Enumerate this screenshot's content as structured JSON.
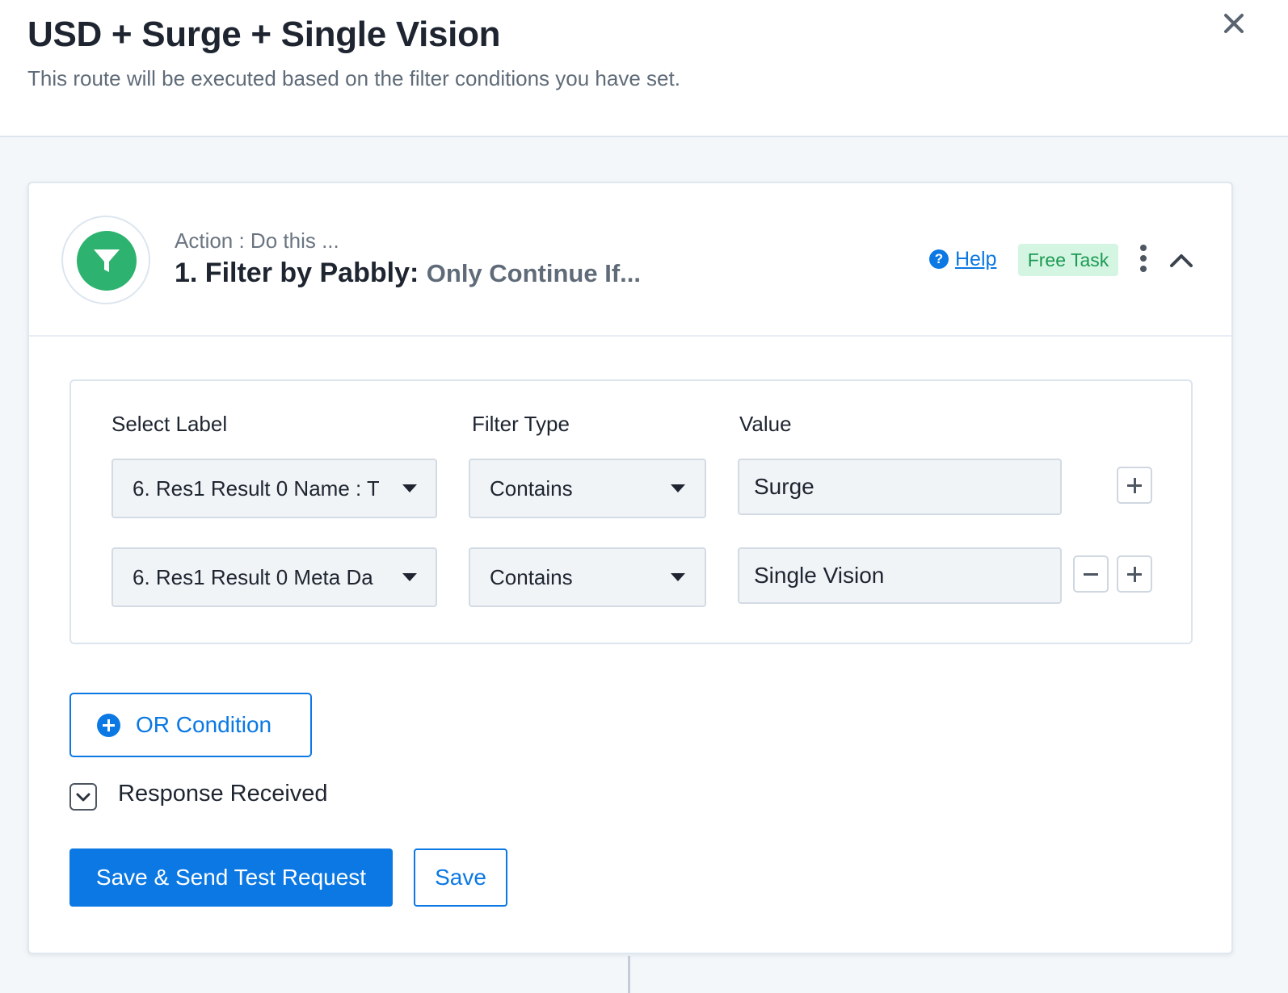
{
  "modal": {
    "title": "USD + Surge + Single Vision",
    "subtitle": "This route will be executed based on the filter conditions you have set.",
    "close_icon": "close-icon"
  },
  "step": {
    "caption": "Action : Do this ...",
    "title": "1. Filter by Pabbly:",
    "subtitle": "Only Continue If...",
    "app_icon": "filter-icon",
    "app_color": "#2db36f",
    "help_label": "Help",
    "badge_label": "Free Task",
    "badge_color": "#d5f5e3"
  },
  "filter": {
    "columns": {
      "label": "Select Label",
      "type": "Filter Type",
      "value": "Value"
    },
    "rows": [
      {
        "label": "6. Res1 Result 0 Name : T",
        "type": "Contains",
        "value": "Surge"
      },
      {
        "label": "6. Res1 Result 0 Meta Da",
        "type": "Contains",
        "value": "Single Vision"
      }
    ]
  },
  "or_condition_label": "OR Condition",
  "response_label": "Response Received",
  "buttons": {
    "save_send": "Save & Send Test Request",
    "save": "Save"
  },
  "colors": {
    "accent": "#0b78e3",
    "background": "#f3f7fa"
  }
}
